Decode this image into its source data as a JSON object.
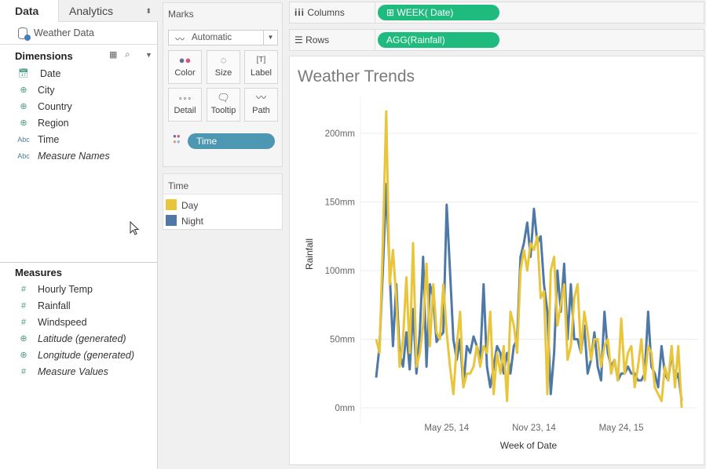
{
  "left_panel": {
    "tabs": [
      {
        "label": "Data",
        "active": true
      },
      {
        "label": "Analytics",
        "active": false
      }
    ],
    "datasource": "Weather Data",
    "dimensions_title": "Dimensions",
    "dimensions": [
      {
        "label": "Date",
        "icon": "calendar-icon",
        "type": "date"
      },
      {
        "label": "City",
        "icon": "globe-icon",
        "type": "geo"
      },
      {
        "label": "Country",
        "icon": "globe-icon",
        "type": "geo"
      },
      {
        "label": "Region",
        "icon": "globe-icon",
        "type": "geo"
      },
      {
        "label": "Time",
        "icon": "Abc",
        "type": "string"
      },
      {
        "label": "Measure Names",
        "icon": "Abc",
        "type": "string",
        "italic": true
      }
    ],
    "measures_title": "Measures",
    "measures": [
      {
        "label": "Hourly Temp",
        "icon": "#"
      },
      {
        "label": "Rainfall",
        "icon": "#"
      },
      {
        "label": "Windspeed",
        "icon": "#"
      },
      {
        "label": "Latitude (generated)",
        "icon": "globe-icon",
        "italic": true
      },
      {
        "label": "Longitude (generated)",
        "icon": "globe-icon",
        "italic": true
      },
      {
        "label": "Measure Values",
        "icon": "#",
        "italic": true
      }
    ]
  },
  "marks": {
    "title": "Marks",
    "mark_type": "Automatic",
    "buttons": [
      "Color",
      "Size",
      "Label",
      "Detail",
      "Tooltip",
      "Path"
    ],
    "color_pill": "Time"
  },
  "legend": {
    "title": "Time",
    "items": [
      {
        "label": "Day",
        "color": "#e8c53a"
      },
      {
        "label": "Night",
        "color": "#4e79a7"
      }
    ]
  },
  "shelves": {
    "columns_label": "Columns",
    "columns_pill": "WEEK( Date)",
    "rows_label": "Rows",
    "rows_pill": "AGG(Rainfall)"
  },
  "chart_data": {
    "type": "line",
    "title": "Weather Trends",
    "xlabel": "Week of Date",
    "ylabel": "Rainfall",
    "ylim": [
      0,
      220
    ],
    "y_ticks": [
      {
        "v": 0,
        "label": "0mm"
      },
      {
        "v": 50,
        "label": "50mm"
      },
      {
        "v": 100,
        "label": "100mm"
      },
      {
        "v": 150,
        "label": "150mm"
      },
      {
        "v": 200,
        "label": "200mm"
      }
    ],
    "x_range": [
      0,
      91
    ],
    "x_ticks": [
      {
        "week": 21,
        "label": "May 25, 14"
      },
      {
        "week": 47,
        "label": "Nov 23, 14"
      },
      {
        "week": 73,
        "label": "May 24, 15"
      }
    ],
    "grid": true,
    "series": [
      {
        "name": "Night",
        "color": "#4e79a7",
        "values": [
          22,
          45,
          100,
          163,
          100,
          45,
          90,
          40,
          30,
          55,
          28,
          72,
          25,
          55,
          110,
          30,
          90,
          80,
          48,
          52,
          55,
          148,
          100,
          50,
          35,
          50,
          15,
          45,
          40,
          52,
          45,
          35,
          90,
          30,
          15,
          30,
          45,
          40,
          25,
          40,
          25,
          45,
          50,
          110,
          120,
          135,
          110,
          145,
          120,
          125,
          90,
          70,
          10,
          40,
          100,
          70,
          105,
          50,
          90,
          50,
          50,
          40,
          60,
          25,
          35,
          55,
          30,
          20,
          70,
          40,
          30,
          35,
          20,
          25,
          25,
          30,
          25,
          25,
          20,
          20,
          25,
          70,
          30,
          25,
          15,
          45,
          25,
          20,
          40,
          20,
          25,
          5
        ]
      },
      {
        "name": "Day",
        "color": "#e8c53a",
        "values": [
          50,
          40,
          120,
          216,
          90,
          115,
          80,
          30,
          50,
          95,
          40,
          120,
          30,
          40,
          60,
          105,
          45,
          90,
          55,
          50,
          90,
          55,
          30,
          10,
          45,
          70,
          15,
          25,
          25,
          30,
          45,
          30,
          45,
          40,
          70,
          10,
          40,
          25,
          45,
          5,
          70,
          60,
          40,
          100,
          115,
          100,
          120,
          115,
          125,
          80,
          85,
          10,
          100,
          110,
          60,
          75,
          90,
          35,
          45,
          80,
          90,
          40,
          70,
          55,
          35,
          50,
          50,
          30,
          45,
          50,
          25,
          35,
          20,
          65,
          25,
          40,
          45,
          15,
          30,
          50,
          20,
          45,
          40,
          15,
          10,
          5,
          30,
          20,
          45,
          15,
          45,
          0
        ]
      }
    ]
  }
}
